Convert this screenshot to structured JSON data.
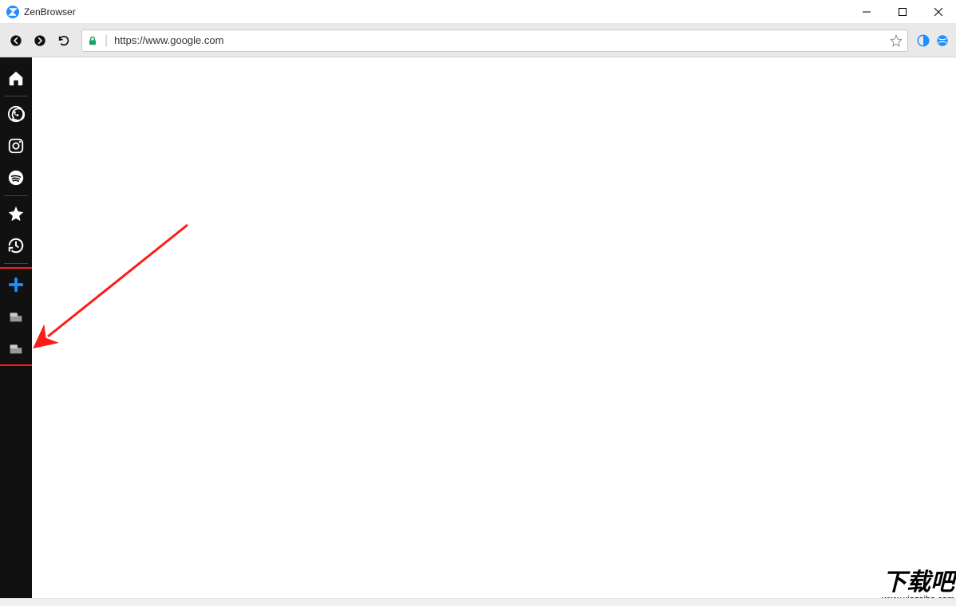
{
  "window": {
    "title": "ZenBrowser"
  },
  "toolbar": {
    "url": "https://www.google.com"
  },
  "sidebar": {
    "items": [
      {
        "name": "home"
      },
      {
        "name": "whatsapp"
      },
      {
        "name": "instagram"
      },
      {
        "name": "spotify"
      },
      {
        "name": "bookmarks"
      },
      {
        "name": "history"
      }
    ],
    "tabs": [
      {
        "name": "new-tab"
      },
      {
        "name": "tab-1"
      },
      {
        "name": "tab-2"
      }
    ]
  },
  "watermark": {
    "big": "下载吧",
    "small": "www.xiazaiba.com"
  }
}
